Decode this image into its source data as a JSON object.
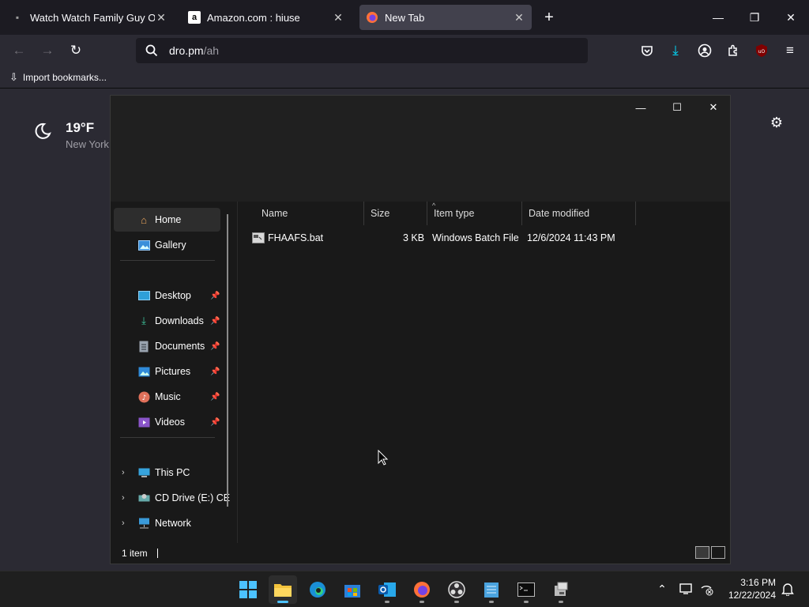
{
  "browser": {
    "tabs": [
      {
        "title": "Watch Watch Family Guy Online",
        "favicon": "site-icon"
      },
      {
        "title": "Amazon.com : hiuse",
        "favicon": "amazon-icon"
      },
      {
        "title": "New Tab",
        "favicon": "firefox-icon"
      }
    ],
    "new_tab_symbol": "+",
    "url_host": "dro.pm",
    "url_path": "/ah",
    "bookmarks_item": "Import bookmarks...",
    "weather": {
      "temp": "19°F",
      "city": "New York"
    }
  },
  "explorer": {
    "nav": {
      "home": "Home",
      "gallery": "Gallery",
      "desktop": "Desktop",
      "downloads": "Downloads",
      "documents": "Documents",
      "pictures": "Pictures",
      "music": "Music",
      "videos": "Videos",
      "this_pc": "This PC",
      "cd_drive": "CD Drive (E:) CE",
      "network": "Network"
    },
    "columns": {
      "name": "Name",
      "size": "Size",
      "type": "Item type",
      "modified": "Date modified"
    },
    "files": [
      {
        "name": "FHAAFS.bat",
        "size": "3 KB",
        "type": "Windows Batch File",
        "modified": "12/6/2024 11:43 PM"
      }
    ],
    "status": "1 item"
  },
  "taskbar": {
    "time": "3:16 PM",
    "date": "12/22/2024",
    "accent": "#4cc2ff"
  }
}
